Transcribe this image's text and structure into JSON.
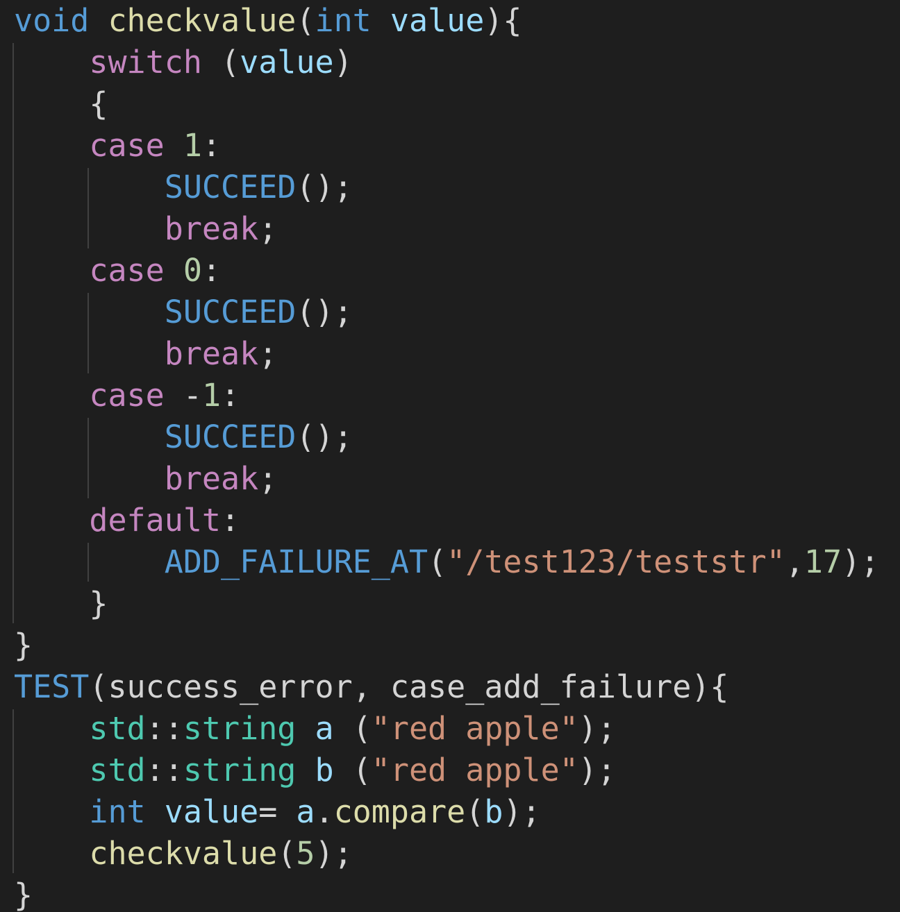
{
  "colors": {
    "background": "#1e1e1e",
    "indent_guide": "#404040",
    "keyword_blue": "#569cd6",
    "control_purple": "#c586c0",
    "function_yellow": "#dcdcaa",
    "variable_lightblue": "#9cdcfe",
    "type_teal": "#4ec9b0",
    "number_green": "#b5cea8",
    "string_orange": "#ce9178",
    "punctuation": "#d4d4d4"
  },
  "lines": [
    [
      [
        "void",
        "#569cd6"
      ],
      [
        " ",
        "#d4d4d4"
      ],
      [
        "checkvalue",
        "#dcdcaa"
      ],
      [
        "(",
        "#d4d4d4"
      ],
      [
        "int",
        "#569cd6"
      ],
      [
        " ",
        "#d4d4d4"
      ],
      [
        "value",
        "#9cdcfe"
      ],
      [
        "){",
        "#d4d4d4"
      ]
    ],
    [
      [
        "    ",
        "#d4d4d4"
      ],
      [
        "switch",
        "#c586c0"
      ],
      [
        " (",
        "#d4d4d4"
      ],
      [
        "value",
        "#9cdcfe"
      ],
      [
        ")",
        "#d4d4d4"
      ]
    ],
    [
      [
        "    {",
        "#d4d4d4"
      ]
    ],
    [
      [
        "    ",
        "#d4d4d4"
      ],
      [
        "case",
        "#c586c0"
      ],
      [
        " ",
        "#d4d4d4"
      ],
      [
        "1",
        "#b5cea8"
      ],
      [
        ":",
        "#d4d4d4"
      ]
    ],
    [
      [
        "        ",
        "#d4d4d4"
      ],
      [
        "SUCCEED",
        "#569cd6"
      ],
      [
        "();",
        "#d4d4d4"
      ]
    ],
    [
      [
        "        ",
        "#d4d4d4"
      ],
      [
        "break",
        "#c586c0"
      ],
      [
        ";",
        "#d4d4d4"
      ]
    ],
    [
      [
        "    ",
        "#d4d4d4"
      ],
      [
        "case",
        "#c586c0"
      ],
      [
        " ",
        "#d4d4d4"
      ],
      [
        "0",
        "#b5cea8"
      ],
      [
        ":",
        "#d4d4d4"
      ]
    ],
    [
      [
        "        ",
        "#d4d4d4"
      ],
      [
        "SUCCEED",
        "#569cd6"
      ],
      [
        "();",
        "#d4d4d4"
      ]
    ],
    [
      [
        "        ",
        "#d4d4d4"
      ],
      [
        "break",
        "#c586c0"
      ],
      [
        ";",
        "#d4d4d4"
      ]
    ],
    [
      [
        "    ",
        "#d4d4d4"
      ],
      [
        "case",
        "#c586c0"
      ],
      [
        " -",
        "#d4d4d4"
      ],
      [
        "1",
        "#b5cea8"
      ],
      [
        ":",
        "#d4d4d4"
      ]
    ],
    [
      [
        "        ",
        "#d4d4d4"
      ],
      [
        "SUCCEED",
        "#569cd6"
      ],
      [
        "();",
        "#d4d4d4"
      ]
    ],
    [
      [
        "        ",
        "#d4d4d4"
      ],
      [
        "break",
        "#c586c0"
      ],
      [
        ";",
        "#d4d4d4"
      ]
    ],
    [
      [
        "    ",
        "#d4d4d4"
      ],
      [
        "default",
        "#c586c0"
      ],
      [
        ":",
        "#d4d4d4"
      ]
    ],
    [
      [
        "        ",
        "#d4d4d4"
      ],
      [
        "ADD_FAILURE_AT",
        "#569cd6"
      ],
      [
        "(",
        "#d4d4d4"
      ],
      [
        "\"/test123/teststr\"",
        "#ce9178"
      ],
      [
        ",",
        "#d4d4d4"
      ],
      [
        "17",
        "#b5cea8"
      ],
      [
        ");",
        "#d4d4d4"
      ]
    ],
    [
      [
        "    }",
        "#d4d4d4"
      ]
    ],
    [
      [
        "}",
        "#d4d4d4"
      ]
    ],
    [
      [
        "TEST",
        "#569cd6"
      ],
      [
        "(success_error, case_add_failure){",
        "#d4d4d4"
      ]
    ],
    [
      [
        "    ",
        "#d4d4d4"
      ],
      [
        "std",
        "#4ec9b0"
      ],
      [
        "::",
        "#d4d4d4"
      ],
      [
        "string",
        "#4ec9b0"
      ],
      [
        " ",
        "#d4d4d4"
      ],
      [
        "a",
        "#9cdcfe"
      ],
      [
        " (",
        "#d4d4d4"
      ],
      [
        "\"red apple\"",
        "#ce9178"
      ],
      [
        ");",
        "#d4d4d4"
      ]
    ],
    [
      [
        "    ",
        "#d4d4d4"
      ],
      [
        "std",
        "#4ec9b0"
      ],
      [
        "::",
        "#d4d4d4"
      ],
      [
        "string",
        "#4ec9b0"
      ],
      [
        " ",
        "#d4d4d4"
      ],
      [
        "b",
        "#9cdcfe"
      ],
      [
        " (",
        "#d4d4d4"
      ],
      [
        "\"red apple\"",
        "#ce9178"
      ],
      [
        ");",
        "#d4d4d4"
      ]
    ],
    [
      [
        "    ",
        "#d4d4d4"
      ],
      [
        "int",
        "#569cd6"
      ],
      [
        " ",
        "#d4d4d4"
      ],
      [
        "value",
        "#9cdcfe"
      ],
      [
        "= ",
        "#d4d4d4"
      ],
      [
        "a",
        "#9cdcfe"
      ],
      [
        ".",
        "#d4d4d4"
      ],
      [
        "compare",
        "#dcdcaa"
      ],
      [
        "(",
        "#d4d4d4"
      ],
      [
        "b",
        "#9cdcfe"
      ],
      [
        ");",
        "#d4d4d4"
      ]
    ],
    [
      [
        "    ",
        "#d4d4d4"
      ],
      [
        "checkvalue",
        "#dcdcaa"
      ],
      [
        "(",
        "#d4d4d4"
      ],
      [
        "5",
        "#b5cea8"
      ],
      [
        ");",
        "#d4d4d4"
      ]
    ],
    [
      [
        "}",
        "#d4d4d4"
      ]
    ]
  ]
}
